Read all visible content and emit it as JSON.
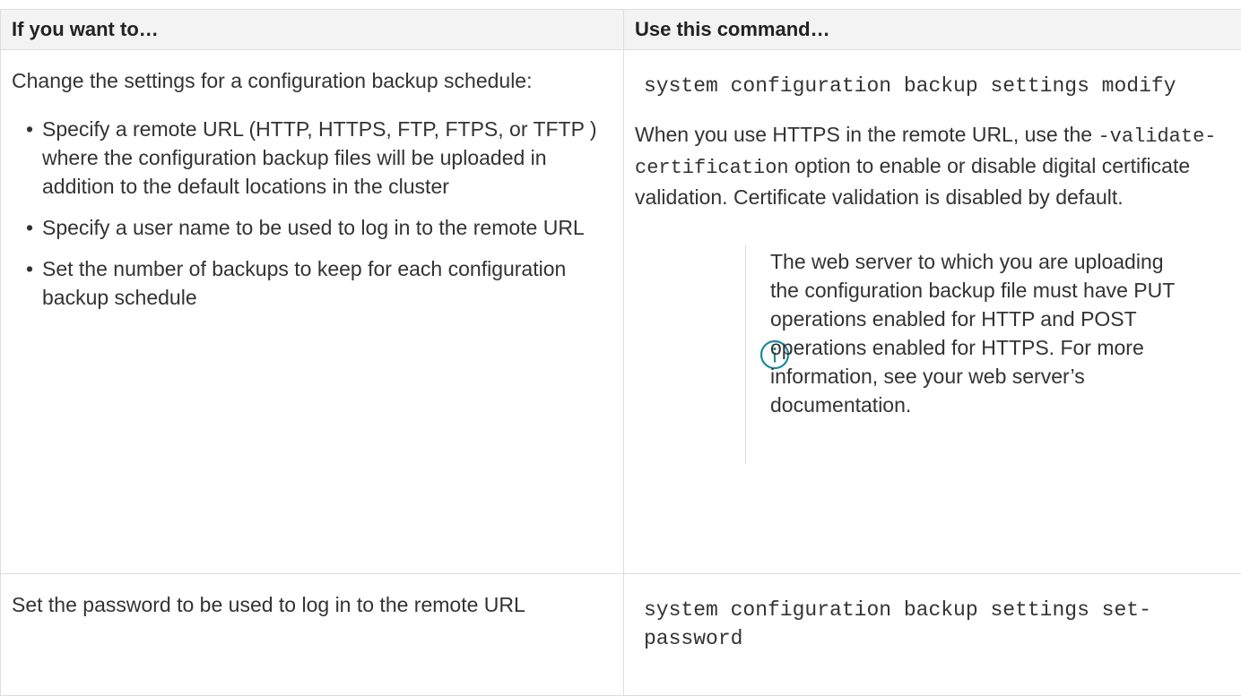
{
  "table": {
    "header": {
      "col1": "If you want to…",
      "col2": "Use this command…"
    },
    "rows": [
      {
        "intro": "Change the settings for a configuration backup schedule:",
        "bullets": [
          "Specify a remote URL (HTTP, HTTPS, FTP, FTPS, or TFTP ) where the configuration backup files will be uploaded in addition to the default locations in the cluster",
          "Specify a user name to be used to log in to the remote URL",
          "Set the number of backups to keep for each configuration backup schedule"
        ],
        "command": "system configuration backup settings modify",
        "note_before": "When you use HTTPS in the remote URL, use the",
        "note_code": "-validate-certification",
        "note_after": "option to enable or disable digital certificate validation. Certificate validation is disabled by default.",
        "admonition": {
          "icon": "info-icon",
          "text": "The web server to which you are uploading the configuration backup file must have PUT operations enabled for HTTP and POST operations enabled for HTTPS. For more information, see your web server’s documentation."
        }
      },
      {
        "intro": "Set the password to be used to log in to the remote URL",
        "command": "system configuration backup settings set-password"
      }
    ]
  },
  "colors": {
    "border": "#dddddd",
    "header_bg": "#f3f3f3",
    "text": "#333333",
    "info_icon": "#1a8a99"
  }
}
